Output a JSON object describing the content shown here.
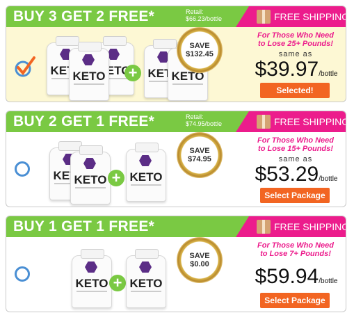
{
  "packages": [
    {
      "title": "BUY 3 GET 2 FREE*",
      "retail_line1": "Retail:",
      "retail_line2": "$66.23/bottle",
      "shipping": "FREE SHIPPING",
      "pitch_line1": "For Those Who Need",
      "pitch_line2": "to Lose 25+ Pounds!",
      "same_as": "same as",
      "price": "$39.97",
      "unit": "/bottle",
      "save_label": "SAVE",
      "save_amount": "$132.45",
      "button": "Selected!",
      "selected": true
    },
    {
      "title": "BUY 2 GET 1 FREE*",
      "retail_line1": "Retail:",
      "retail_line2": "$74.95/bottle",
      "shipping": "FREE SHIPPING",
      "pitch_line1": "For Those Who Need",
      "pitch_line2": "to Lose 15+ Pounds!",
      "same_as": "same as",
      "price": "$53.29",
      "unit": "/bottle",
      "save_label": "SAVE",
      "save_amount": "$74.95",
      "button": "Select Package",
      "selected": false
    },
    {
      "title": "BUY 1 GET 1 FREE*",
      "shipping": "FREE SHIPPING",
      "pitch_line1": "For Those Who Need",
      "pitch_line2": "to Lose 7+ Pounds!",
      "price": "$59.94",
      "unit": "/bottle",
      "save_label": "SAVE",
      "save_amount": "$0.00",
      "button": "Select Package",
      "selected": false
    }
  ],
  "product_label": "KETO",
  "colors": {
    "green": "#7ac943",
    "pink": "#ec1c8c",
    "orange": "#f26522",
    "radio": "#4a8fd4",
    "selected_bg": "#fdf8d4"
  }
}
